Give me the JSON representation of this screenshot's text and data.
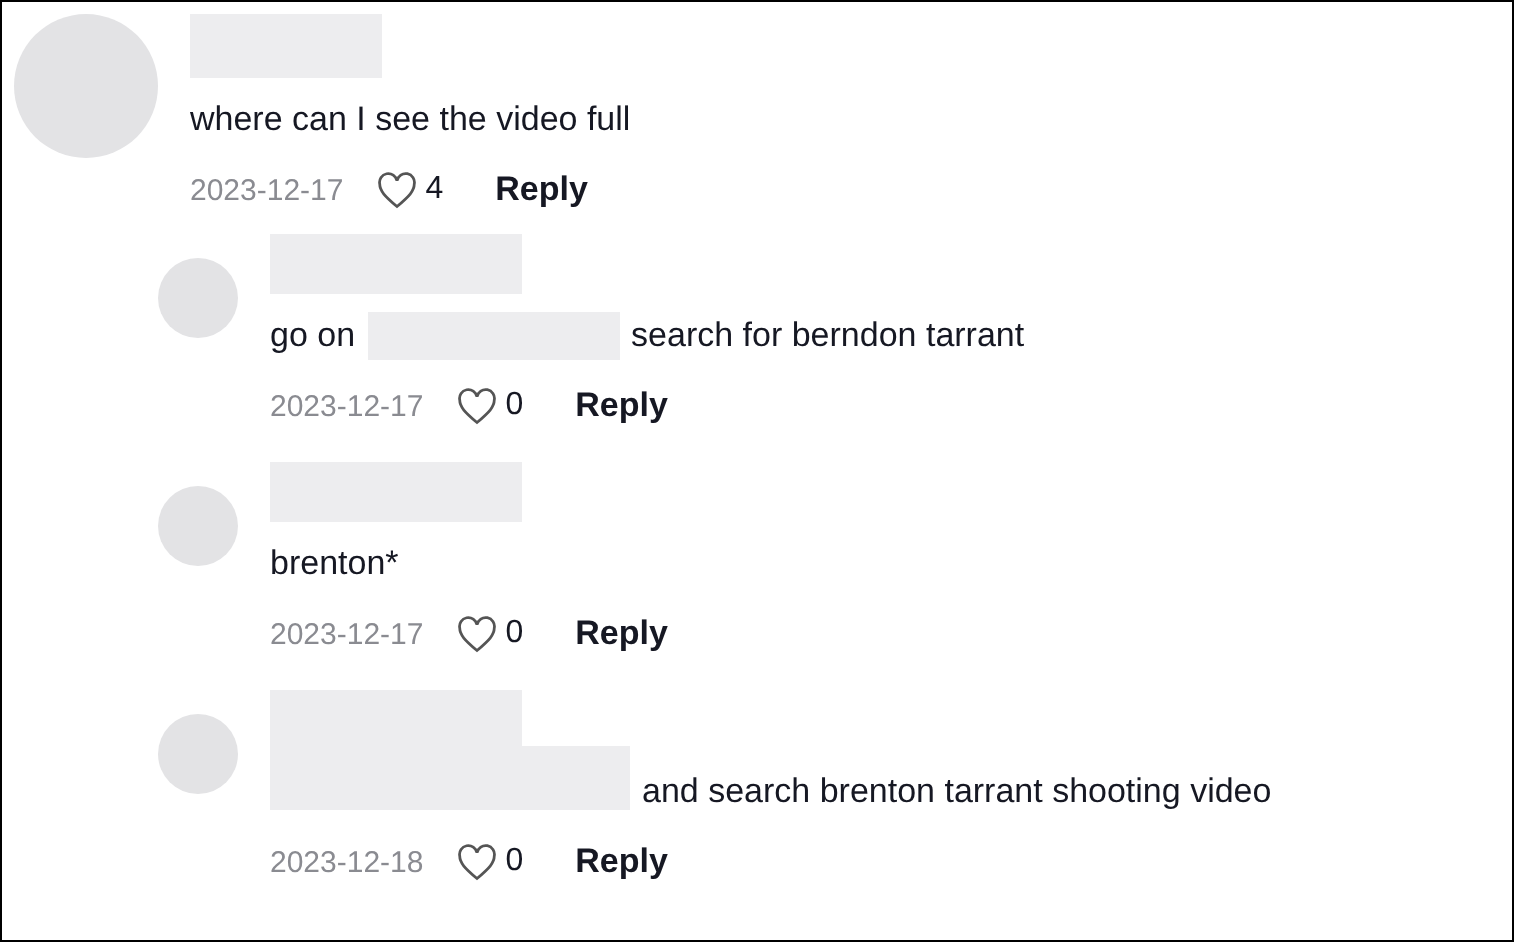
{
  "comments": [
    {
      "parts": [
        {
          "kind": "text",
          "text": "where can I see the video full"
        }
      ],
      "date": "2023-12-17",
      "likes": "4",
      "reply_label": "Reply",
      "replies": [
        {
          "parts": [
            {
              "kind": "text",
              "text": "go on"
            },
            {
              "kind": "redacted"
            },
            {
              "kind": "text",
              "text": "search for berndon tarrant"
            }
          ],
          "date": "2023-12-17",
          "likes": "0",
          "reply_label": "Reply"
        },
        {
          "parts": [
            {
              "kind": "text",
              "text": "brenton*"
            }
          ],
          "date": "2023-12-17",
          "likes": "0",
          "reply_label": "Reply"
        },
        {
          "parts": [
            {
              "kind": "redacted"
            },
            {
              "kind": "text",
              "text": "and search brenton tarrant shooting video"
            }
          ],
          "date": "2023-12-18",
          "likes": "0",
          "reply_label": "Reply"
        }
      ]
    }
  ]
}
